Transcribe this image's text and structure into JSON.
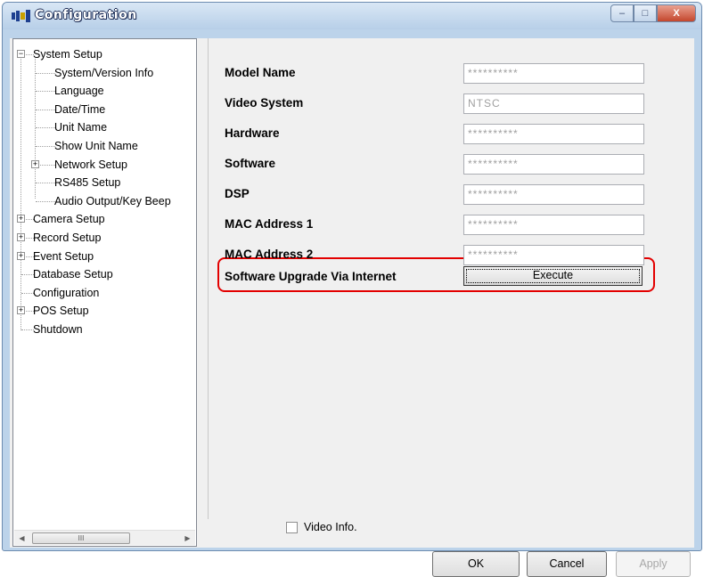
{
  "window": {
    "title": "Configuration",
    "controls": {
      "minimize": "–",
      "maximize": "□",
      "close": "X"
    }
  },
  "tree": {
    "items": [
      {
        "label": "System Setup",
        "expander": "−"
      },
      {
        "label": "System/Version Info"
      },
      {
        "label": "Language"
      },
      {
        "label": "Date/Time"
      },
      {
        "label": "Unit Name"
      },
      {
        "label": "Show Unit Name"
      },
      {
        "label": "Network Setup",
        "expander": "+"
      },
      {
        "label": "RS485 Setup"
      },
      {
        "label": "Audio Output/Key Beep"
      },
      {
        "label": "Camera Setup",
        "expander": "+"
      },
      {
        "label": "Record Setup",
        "expander": "+"
      },
      {
        "label": "Event Setup",
        "expander": "+"
      },
      {
        "label": "Database Setup"
      },
      {
        "label": "Configuration"
      },
      {
        "label": "POS Setup",
        "expander": "+"
      },
      {
        "label": "Shutdown"
      }
    ],
    "scroll": {
      "left": "◀",
      "right": "▶",
      "thumb": "III"
    }
  },
  "fields": [
    {
      "label": "Model Name",
      "value": "**********"
    },
    {
      "label": "Video System",
      "value": "NTSC"
    },
    {
      "label": "Hardware",
      "value": "**********"
    },
    {
      "label": "Software",
      "value": "**********"
    },
    {
      "label": "DSP",
      "value": "**********"
    },
    {
      "label": "MAC Address 1",
      "value": "**********"
    },
    {
      "label": "MAC Address 2",
      "value": "**********"
    }
  ],
  "upgrade": {
    "label": "Software Upgrade Via Internet",
    "button": "Execute"
  },
  "video_info": {
    "label": "Video Info.",
    "checked": false
  },
  "buttons": {
    "ok": "OK",
    "cancel": "Cancel",
    "apply": "Apply"
  },
  "colors": {
    "highlight": "#e30000",
    "title_text": "#ffffff"
  }
}
